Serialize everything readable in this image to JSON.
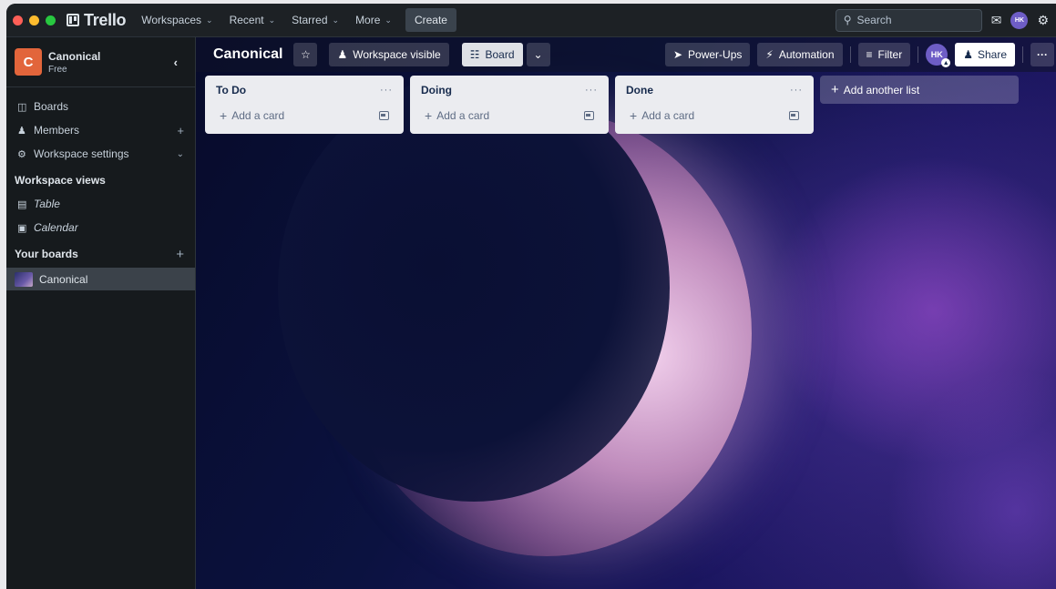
{
  "window": {
    "traffic_colors": [
      "#ff5f57",
      "#febc2e",
      "#28c840"
    ]
  },
  "topbar": {
    "app_name": "Trello",
    "nav": [
      {
        "label": "Workspaces"
      },
      {
        "label": "Recent"
      },
      {
        "label": "Starred"
      },
      {
        "label": "More"
      }
    ],
    "create_label": "Create",
    "search_placeholder": "Search",
    "user_initials": "HK"
  },
  "sidebar": {
    "workspace_initial": "C",
    "workspace_name": "Canonical",
    "workspace_plan": "Free",
    "items": [
      {
        "label": "Boards",
        "icon": "boards-icon"
      },
      {
        "label": "Members",
        "icon": "person-icon"
      },
      {
        "label": "Workspace settings",
        "icon": "gear-icon"
      }
    ],
    "views_heading": "Workspace views",
    "views": [
      {
        "label": "Table",
        "icon": "table-icon"
      },
      {
        "label": "Calendar",
        "icon": "calendar-icon"
      }
    ],
    "boards_heading": "Your boards",
    "boards": [
      {
        "label": "Canonical"
      }
    ]
  },
  "board": {
    "title": "Canonical",
    "visibility_label": "Workspace visible",
    "view_label": "Board",
    "powerups_label": "Power-Ups",
    "automation_label": "Automation",
    "filter_label": "Filter",
    "member_initials": "HK",
    "share_label": "Share",
    "lists": [
      {
        "title": "To Do",
        "add_card": "Add a card"
      },
      {
        "title": "Doing",
        "add_card": "Add a card"
      },
      {
        "title": "Done",
        "add_card": "Add a card"
      }
    ],
    "add_list_label": "Add another list"
  }
}
